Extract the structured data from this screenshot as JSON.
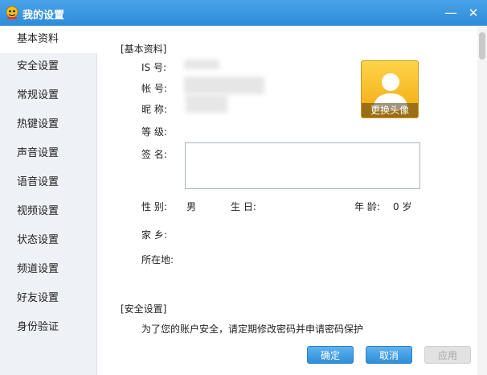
{
  "window": {
    "title": "我的设置",
    "minimize_glyph": "—",
    "close_glyph": "✕"
  },
  "sidebar": {
    "items": [
      {
        "label": "基本资料",
        "active": true
      },
      {
        "label": "安全设置"
      },
      {
        "label": "常规设置"
      },
      {
        "label": "热键设置"
      },
      {
        "label": "声音设置"
      },
      {
        "label": "语音设置"
      },
      {
        "label": "视频设置"
      },
      {
        "label": "状态设置"
      },
      {
        "label": "频道设置"
      },
      {
        "label": "好友设置"
      },
      {
        "label": "身份验证"
      }
    ]
  },
  "basic": {
    "section_title": "[基本资料]",
    "is_label": "IS 号:",
    "account_label": "帐 号:",
    "nickname_label": "昵 称:",
    "level_label": "等 级:",
    "signature_label": "签 名:",
    "gender_label": "性 别:",
    "gender_value": "男",
    "birthday_label": "生 日:",
    "age_label": "年 龄:",
    "age_value": "0 岁",
    "hometown_label": "家 乡:",
    "location_label": "所在地:",
    "change_avatar_label": "更换头像"
  },
  "security": {
    "section_title": "[安全设置]",
    "tip": "为了您的账户安全，请定期修改密码并申请密码保护"
  },
  "footer": {
    "ok_label": "确定",
    "cancel_label": "取消",
    "apply_label": "应用"
  },
  "colors": {
    "titlebar": "#2e8bd8",
    "sidebar_bg": "#eef1f5",
    "primary_button": "#2d8fd8",
    "avatar_bg": "#f2a90e"
  }
}
